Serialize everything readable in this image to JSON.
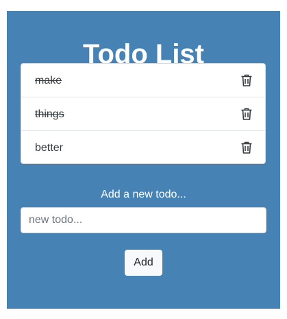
{
  "header": {
    "title": "Todo List"
  },
  "todos": [
    {
      "text": "make",
      "completed": true,
      "delete_icon": "trash-icon"
    },
    {
      "text": "things",
      "completed": true,
      "delete_icon": "trash-icon"
    },
    {
      "text": "better",
      "completed": false,
      "delete_icon": "trash-icon"
    }
  ],
  "form": {
    "label": "Add a new todo...",
    "placeholder": "new todo...",
    "value": "",
    "add_label": "Add"
  },
  "colors": {
    "panel_background": "#4682b4",
    "text_on_panel": "#ffffff",
    "item_text": "#333a40"
  }
}
